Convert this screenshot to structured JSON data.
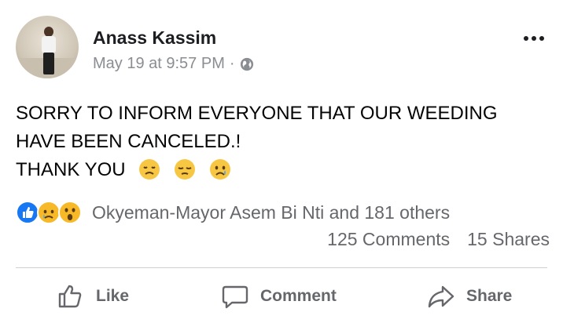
{
  "post": {
    "author": "Anass Kassim",
    "timestamp": "May 19 at 9:57 PM",
    "meta_separator": "·",
    "privacy_icon": "globe-icon",
    "text_line1": "SORRY TO INFORM EVERYONE THAT OUR WEEDING",
    "text_line2": "HAVE BEEN CANCELED.!",
    "text_line3": "THANK YOU",
    "emojis": [
      "disappointed-face-emoji",
      "pensive-face-emoji",
      "crying-face-emoji"
    ]
  },
  "reactions": {
    "icons": [
      "like-reaction-icon",
      "sad-reaction-icon",
      "wow-reaction-icon"
    ],
    "summary": "Okyeman-Mayor Asem Bi Nti and 181 others",
    "comments": "125 Comments",
    "shares": "15 Shares"
  },
  "actions": {
    "like": "Like",
    "comment": "Comment",
    "share": "Share"
  },
  "colors": {
    "like_blue": "#1877f2",
    "reaction_yellow": "#f7b928",
    "secondary_text": "#65676b"
  }
}
